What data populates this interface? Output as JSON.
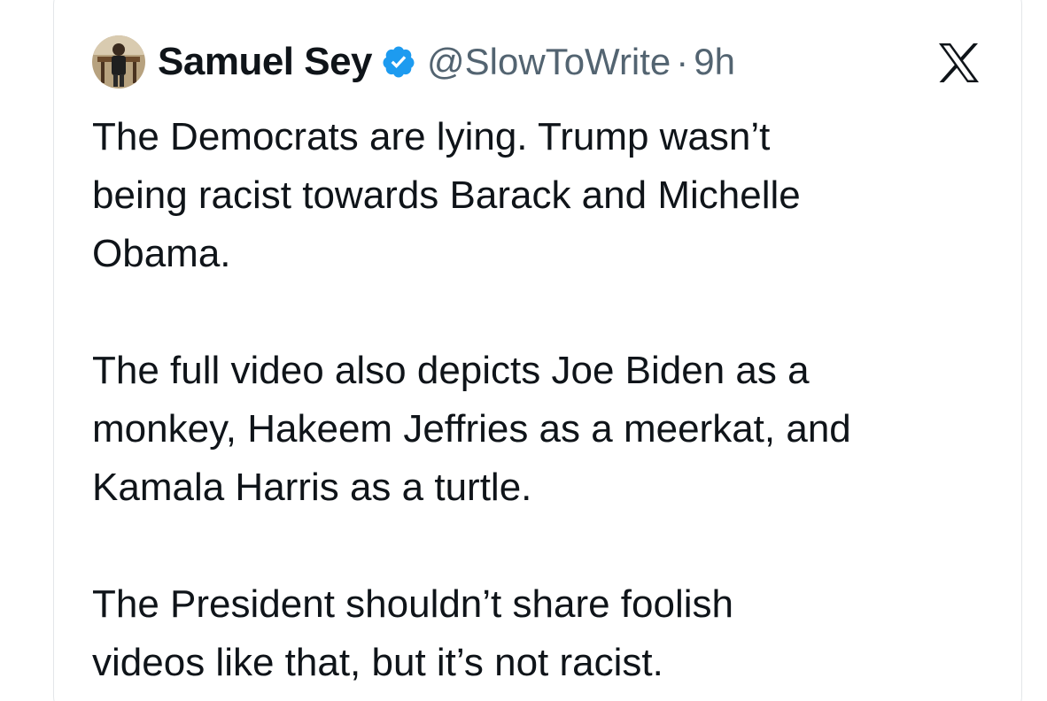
{
  "tweet": {
    "author": {
      "display_name": "Samuel Sey",
      "handle": "@SlowToWrite",
      "verified": true,
      "verified_icon": "verified-badge-icon",
      "avatar_icon": "avatar"
    },
    "separator": "·",
    "timestamp": "9h",
    "platform_icon": "x-logo-icon",
    "paragraphs": [
      "The Democrats are lying. Trump wasn’t\nbeing racist towards Barack and Michelle\nObama.",
      "The full video also depicts Joe Biden as a\nmonkey, Hakeem Jeffries as a meerkat, and\nKamala Harris as a turtle.",
      "The President shouldn’t share foolish\nvideos like that, but it’s not racist."
    ]
  },
  "colors": {
    "text_primary": "#0f1419",
    "text_secondary": "#536471",
    "verified_blue": "#1d9bf0",
    "border": "#e3e6e9"
  }
}
